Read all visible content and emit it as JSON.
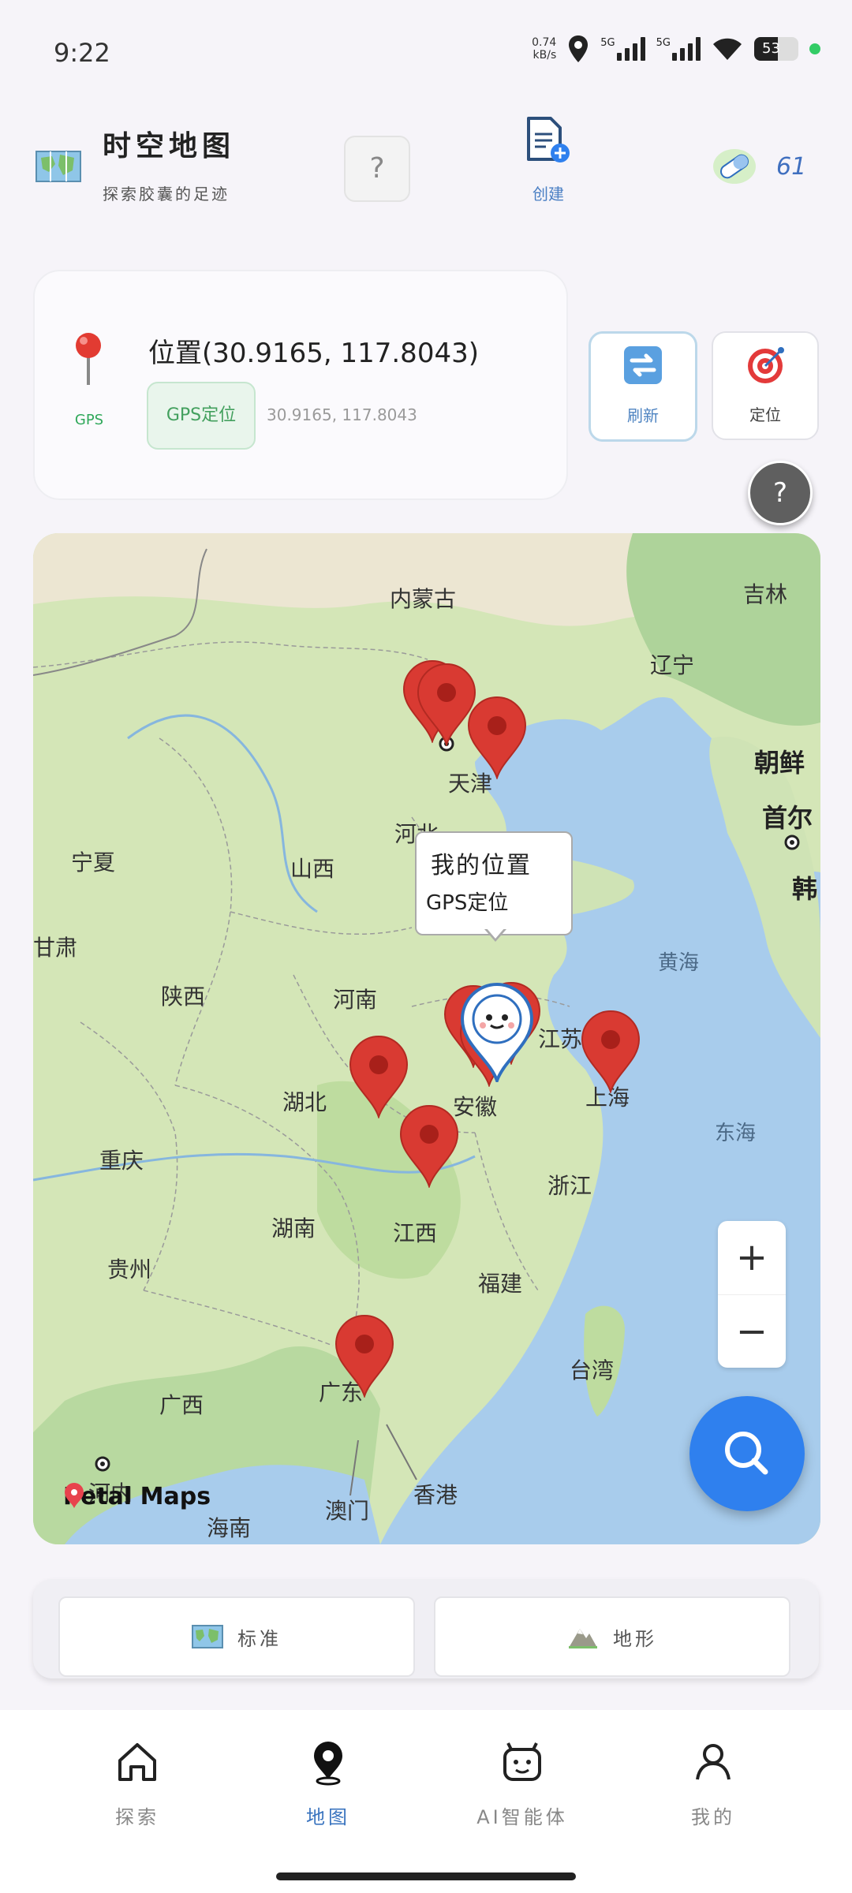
{
  "status_bar": {
    "time": "9:22",
    "net_speed": "0.74",
    "net_unit": "kB/s",
    "sim1": "5G",
    "sim2": "5G",
    "battery": "53"
  },
  "header": {
    "title": "时空地图",
    "subtitle": "探索胶囊的足迹",
    "help": "?",
    "create_label": "创建",
    "coins": "61"
  },
  "location_card": {
    "gps_label": "GPS",
    "position_text": "位置(30.9165, 117.8043)",
    "gps_chip": "GPS定位",
    "coords": "30.9165, 117.8043",
    "refresh_label": "刷新",
    "locate_label": "定位",
    "float_help": "?"
  },
  "map": {
    "bubble_title": "我的位置",
    "bubble_sub": "GPS定位",
    "zoom_in": "+",
    "zoom_out": "−",
    "attribution": "Petal Maps",
    "labels": {
      "neimenggu": "内蒙古",
      "jilin": "吉林",
      "liaoning": "辽宁",
      "tianjin": "天津",
      "chaoxian": "朝鲜",
      "shouer": "首尔",
      "han": "韩",
      "hebei": "河北",
      "ningxia": "宁夏",
      "shanxi": "山西",
      "gansu": "甘肃",
      "huanghai": "黄海",
      "shaanxi": "陕西",
      "henan": "河南",
      "jiangsu": "江苏",
      "anhui": "安徽",
      "hubei": "湖北",
      "shanghai": "上海",
      "donghai": "东海",
      "chongqing": "重庆",
      "zhejiang": "浙江",
      "hunan": "湖南",
      "jiangxi": "江西",
      "guizhou": "贵州",
      "fujian": "福建",
      "taiwan": "台湾",
      "guangxi": "广西",
      "guangdong": "广东",
      "aomen": "澳门",
      "xianggang": "香港",
      "hainan": "海南",
      "henei": "河内"
    }
  },
  "map_type": {
    "standard": "标准",
    "terrain": "地形"
  },
  "nav": {
    "explore": "探索",
    "map": "地图",
    "ai": "AI智能体",
    "mine": "我的"
  },
  "colors": {
    "accent": "#2f80ee",
    "active_nav": "#3a74bf",
    "marker": "#d93a32",
    "gps_green": "#43a05e"
  }
}
